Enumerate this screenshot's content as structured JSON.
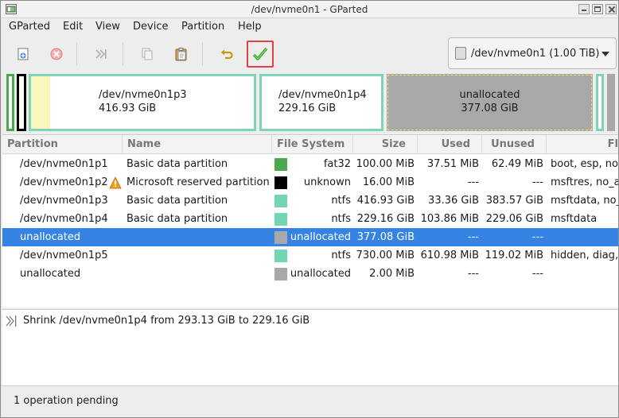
{
  "window": {
    "title": "/dev/nvme0n1 - GParted"
  },
  "menu": {
    "items": [
      "GParted",
      "Edit",
      "View",
      "Device",
      "Partition",
      "Help"
    ]
  },
  "toolbar": {
    "buttons": [
      {
        "icon": "new-partition-icon",
        "enabled": true
      },
      {
        "icon": "delete-icon",
        "enabled": false
      },
      {
        "icon": "resize-move-icon",
        "enabled": false
      },
      {
        "icon": "copy-icon",
        "enabled": false
      },
      {
        "icon": "paste-icon",
        "enabled": true
      },
      {
        "icon": "undo-icon",
        "enabled": true
      },
      {
        "icon": "apply-checkmark-icon",
        "enabled": true,
        "highlighted": true
      }
    ],
    "device_selector": "/dev/nvme0n1 (1.00 TiB)"
  },
  "graph": {
    "partitions": [
      {
        "name": "/dev/nvme0n1p3",
        "size": "416.93 GiB"
      },
      {
        "name": "/dev/nvme0n1p4",
        "size": "229.16 GiB"
      },
      {
        "name": "unallocated",
        "size": "377.08 GiB"
      }
    ]
  },
  "table": {
    "headers": [
      "Partition",
      "Name",
      "File System",
      "Size",
      "Used",
      "Unused",
      "Fl"
    ],
    "rows": [
      {
        "partition": "/dev/nvme0n1p1",
        "name": "Basic data partition",
        "fs": "fat32",
        "fs_color": "#4aa94a",
        "size": "100.00 MiB",
        "used": "37.51 MiB",
        "unused": "62.49 MiB",
        "flags": "boot, esp, no_",
        "warning": false,
        "selected": false
      },
      {
        "partition": "/dev/nvme0n1p2",
        "name": "Microsoft reserved partition",
        "fs": "unknown",
        "fs_color": "#000000",
        "size": "16.00 MiB",
        "used": "---",
        "unused": "---",
        "flags": "msftres, no_a",
        "warning": true,
        "selected": false
      },
      {
        "partition": "/dev/nvme0n1p3",
        "name": "Basic data partition",
        "fs": "ntfs",
        "fs_color": "#73d6b2",
        "size": "416.93 GiB",
        "used": "33.36 GiB",
        "unused": "383.57 GiB",
        "flags": "msftdata, no_",
        "warning": false,
        "selected": false
      },
      {
        "partition": "/dev/nvme0n1p4",
        "name": "Basic data partition",
        "fs": "ntfs",
        "fs_color": "#73d6b2",
        "size": "229.16 GiB",
        "used": "103.86 MiB",
        "unused": "229.06 GiB",
        "flags": "msftdata",
        "warning": false,
        "selected": false
      },
      {
        "partition": "unallocated",
        "name": "",
        "fs": "unallocated",
        "fs_color": "#a8a8a8",
        "size": "377.08 GiB",
        "used": "---",
        "unused": "---",
        "flags": "",
        "warning": false,
        "selected": true
      },
      {
        "partition": "/dev/nvme0n1p5",
        "name": "",
        "fs": "ntfs",
        "fs_color": "#73d6b2",
        "size": "730.00 MiB",
        "used": "610.98 MiB",
        "unused": "119.02 MiB",
        "flags": "hidden, diag,",
        "warning": false,
        "selected": false
      },
      {
        "partition": "unallocated",
        "name": "",
        "fs": "unallocated",
        "fs_color": "#a8a8a8",
        "size": "2.00 MiB",
        "used": "---",
        "unused": "---",
        "flags": "",
        "warning": false,
        "selected": false
      }
    ]
  },
  "operations": {
    "items": [
      "Shrink /dev/nvme0n1p4 from 293.13 GiB to 229.16 GiB"
    ]
  },
  "status": {
    "text": "1 operation pending"
  },
  "colors": {
    "ntfs": "#73d6b2",
    "fat32": "#4aa94a",
    "unallocated": "#a8a8a8",
    "selection": "#3584e4",
    "highlight_border": "#e04040"
  }
}
